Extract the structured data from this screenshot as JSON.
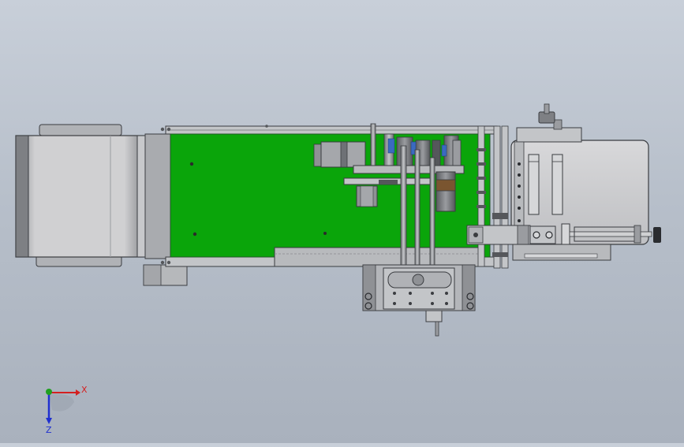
{
  "scene": {
    "colors": {
      "background_top": "#c8cfd9",
      "background_bottom": "#a9b1bd",
      "conveyor_belt": "#0aa50a",
      "frame_gray": "#b8babd",
      "frame_dark": "#6e7176",
      "panel_light": "#dcdcdc",
      "outline": "#3a3c40",
      "motor_dark": "#4a4c50",
      "brown": "#7a5530"
    },
    "components": [
      "infeed-roller-unit",
      "conveyor-belt",
      "labeling-head",
      "pneumatic-slide",
      "discharge-plate",
      "bottom-carriage"
    ]
  },
  "triad": {
    "x_label": "X",
    "z_label": "Z",
    "x_color": "#d42020",
    "y_color": "#20a020",
    "z_color": "#2030d0"
  }
}
